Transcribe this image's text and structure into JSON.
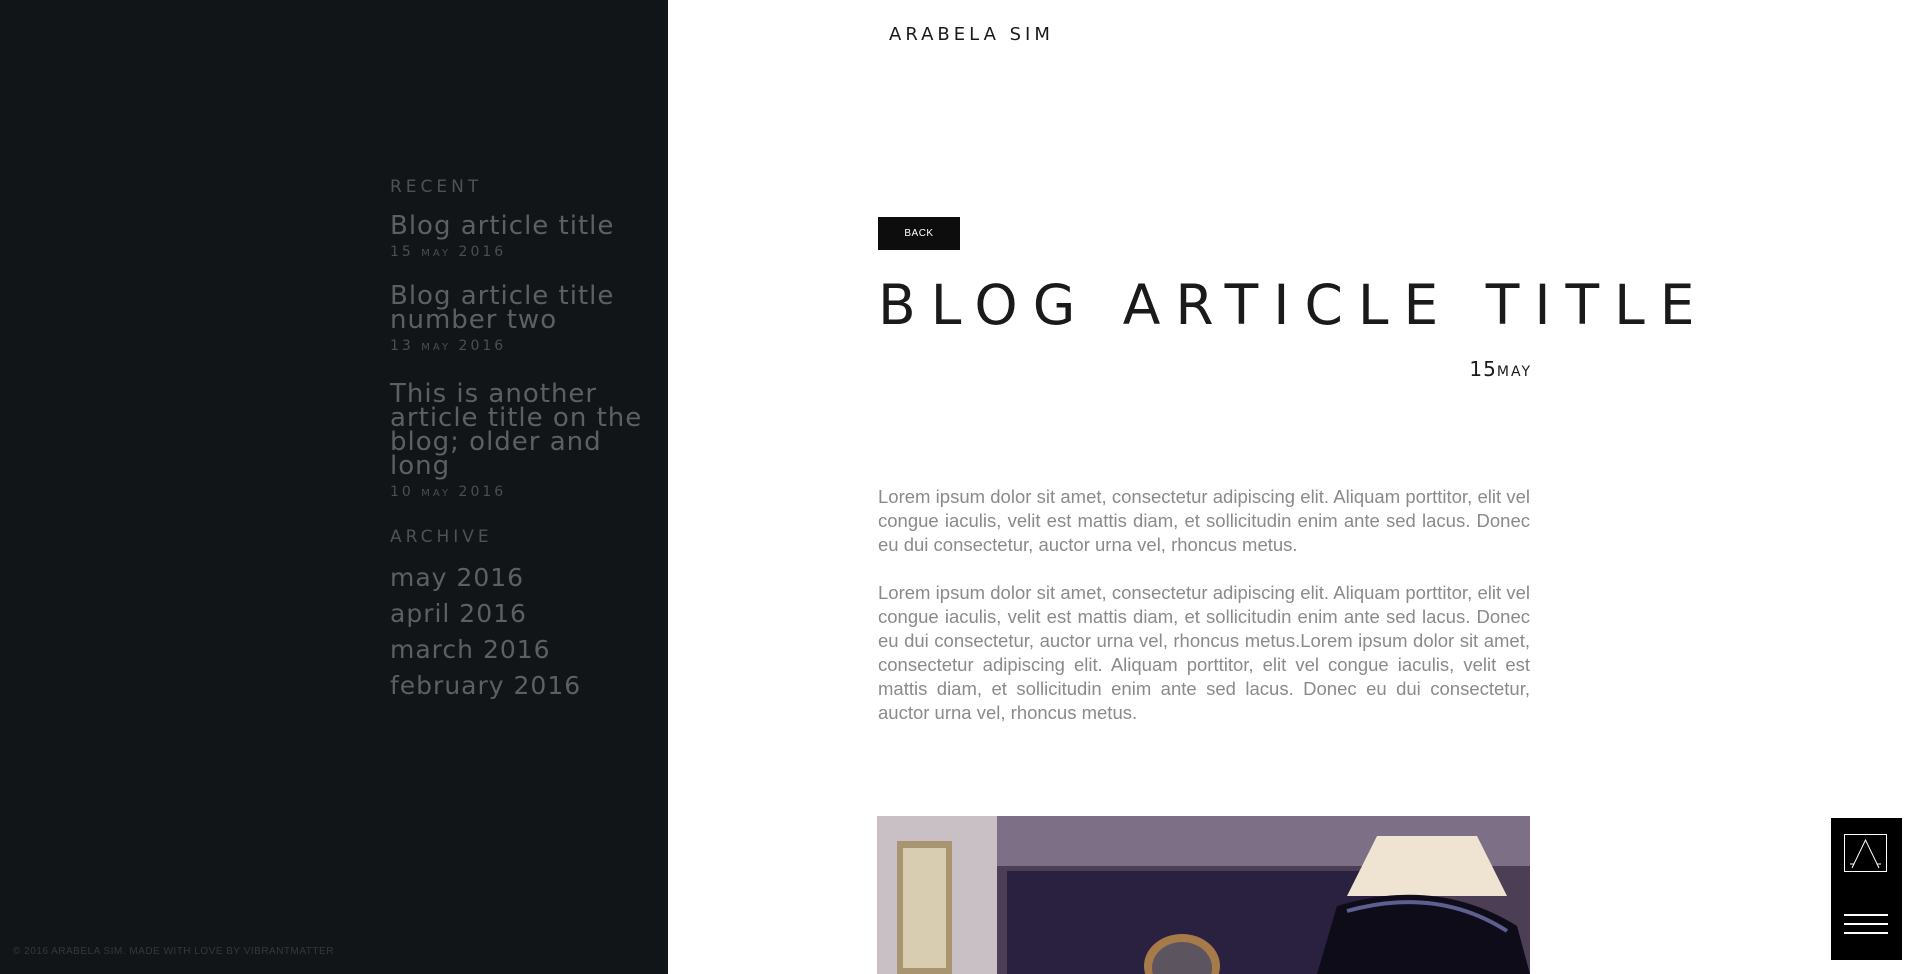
{
  "site": {
    "title": "ARABELA SIM"
  },
  "sidebar": {
    "recent_heading": "RECENT",
    "posts": [
      {
        "title": "Blog article title",
        "day": "15",
        "month": "MAY",
        "year": "2016"
      },
      {
        "title": "Blog article title number two",
        "day": "13",
        "month": "MAY",
        "year": "2016"
      },
      {
        "title": "This is another article title on the blog; older and long",
        "day": "10",
        "month": "MAY",
        "year": "2016"
      }
    ],
    "archive_heading": "ARCHIVE",
    "archive": [
      "may 2016",
      "april 2016",
      "march 2016",
      "february 2016"
    ],
    "footer": "© 2016 ARABELA SIM. MADE WITH LOVE BY VIBRANTMATTER"
  },
  "article": {
    "back_label": "BACK",
    "title": "BLOG ARTICLE TITLE",
    "date_day": "15",
    "date_month": "MAY",
    "paragraphs": [
      "Lorem ipsum dolor sit amet, consectetur adipiscing elit. Aliquam porttitor, elit vel congue iaculis, velit est mattis diam, et sollicitudin enim ante sed lacus. Donec eu dui consectetur, auctor urna vel, rhoncus metus.",
      "Lorem ipsum dolor sit amet, consectetur adipiscing elit. Aliquam porttitor, elit vel congue iaculis, velit est mattis diam, et sollicitudin enim ante sed lacus. Donec eu dui consectetur, auctor urna vel, rhoncus metus.Lorem ipsum dolor sit amet, consectetur adipiscing elit. Aliquam porttitor, elit vel congue iaculis, velit est mattis diam, et sollicitudin enim ante sed lacus. Donec eu dui consectetur, auctor urna vel, rhoncus metus."
    ]
  },
  "widget": {
    "logo_icon": "a-logo-icon",
    "menu_icon": "hamburger-menu-icon"
  }
}
